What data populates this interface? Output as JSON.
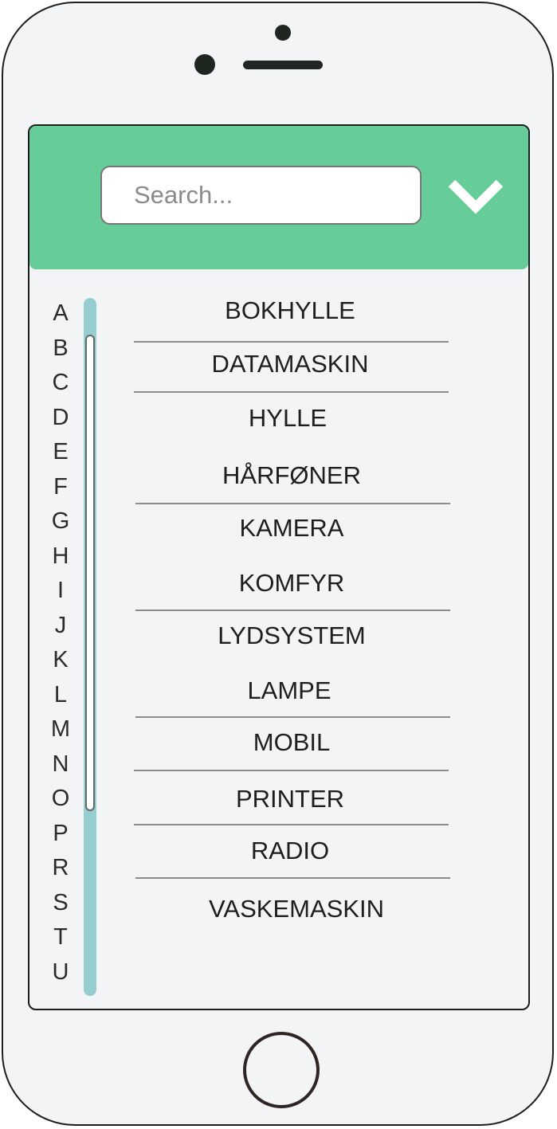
{
  "search": {
    "placeholder": "Search..."
  },
  "icons": {
    "dropdown": "chevron-down-icon"
  },
  "colors": {
    "header": "#66cd99",
    "scrollbar": "#96cdd0",
    "screen_background": "#f3f4f5"
  },
  "alphabet": [
    "A",
    "B",
    "C",
    "D",
    "E",
    "F",
    "G",
    "H",
    "I",
    "J",
    "K",
    "L",
    "M",
    "N",
    "O",
    "P",
    "R",
    "S",
    "T",
    "U"
  ],
  "items": [
    "BOKHYLLE",
    "DATAMASKIN",
    "HYLLE",
    "HÅRFØNER",
    "KAMERA",
    "KOMFYR",
    "LYDSYSTEM",
    "LAMPE",
    "MOBIL",
    "PRINTER",
    "RADIO",
    "VASKEMASKIN"
  ]
}
